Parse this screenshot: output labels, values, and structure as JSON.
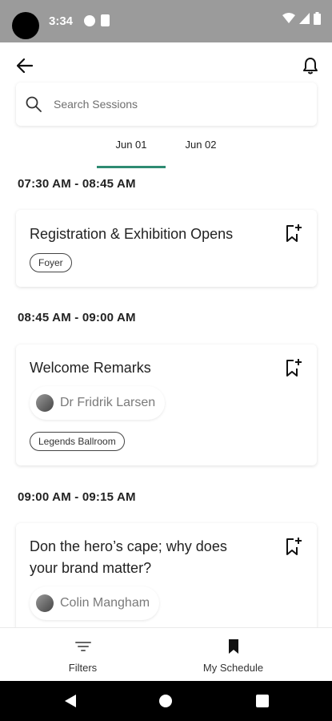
{
  "status_bar": {
    "time": "3:34",
    "icons": [
      "notification-dot-icon",
      "sim-card-icon",
      "wifi-icon",
      "signal-icon",
      "battery-icon"
    ]
  },
  "header": {
    "back_icon": "arrow-left-icon",
    "notification_icon": "bell-icon"
  },
  "search": {
    "placeholder": "Search Sessions",
    "value": ""
  },
  "tabs": [
    {
      "label": "Jun 01",
      "selected": true
    },
    {
      "label": "Jun 02",
      "selected": false
    }
  ],
  "accent_color": "#2e8b72",
  "sessions": [
    {
      "time": "07:30 AM -  08:45 AM",
      "title": "Registration & Exhibition Opens",
      "location": "Foyer"
    },
    {
      "time": "08:45 AM -  09:00 AM",
      "title": "Welcome Remarks",
      "speaker": "Dr Fridrik Larsen",
      "location": "Legends Ballroom"
    },
    {
      "time": "09:00 AM -  09:15 AM",
      "title_line1": "Don the hero’s cape; why does",
      "title_line2": "your brand matter?",
      "speaker": "Colin Mangham"
    }
  ],
  "bottom_nav": {
    "filters_label": "Filters",
    "schedule_label": "My Schedule"
  }
}
